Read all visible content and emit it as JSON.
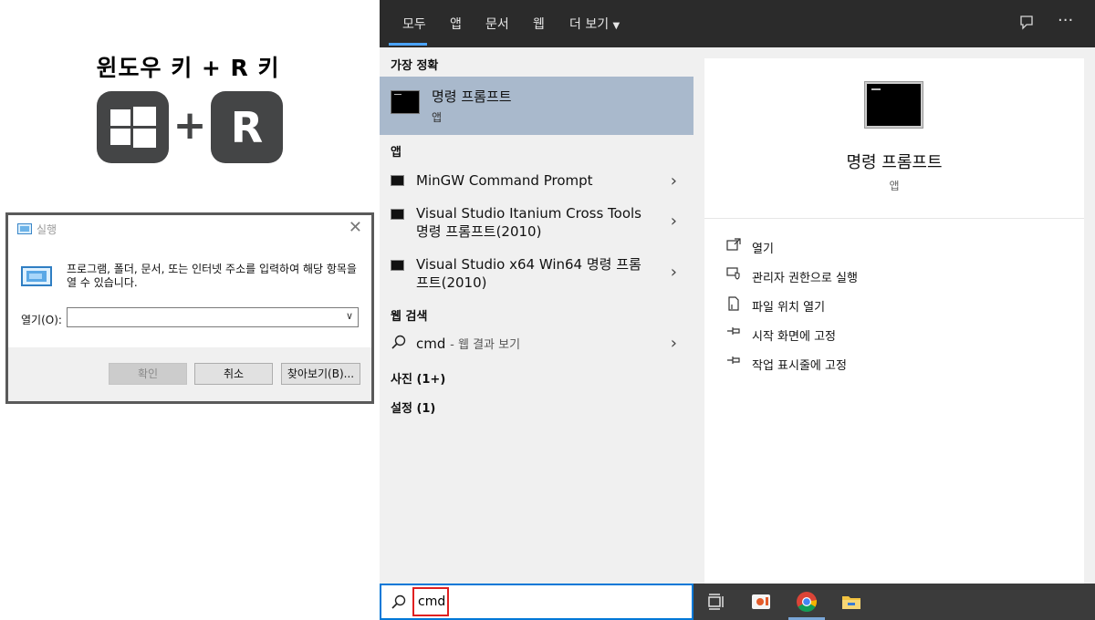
{
  "shortcut": {
    "title": "윈도우 키 + R 키",
    "plus": "+",
    "r_key": "R",
    "win_key_icon": "windows-logo-icon"
  },
  "run_dialog": {
    "title": "실행",
    "description": "프로그램, 폴더, 문서, 또는 인터넷 주소를 입력하여 해당 항목을 열 수 있습니다.",
    "open_label": "열기(O):",
    "open_value": "",
    "ok_label": "확인",
    "cancel_label": "취소",
    "browse_label": "찾아보기(B)..."
  },
  "search": {
    "tabs": [
      {
        "label": "모두"
      },
      {
        "label": "앱"
      },
      {
        "label": "문서"
      },
      {
        "label": "웹"
      },
      {
        "label": "더 보기"
      }
    ],
    "best_match_header": "가장 정확",
    "best_match": {
      "title": "명령 프롬프트",
      "subtitle": "앱"
    },
    "apps_header": "앱",
    "apps": [
      {
        "label": "MinGW Command Prompt"
      },
      {
        "label": "Visual Studio Itanium Cross Tools 명령 프롬프트(2010)"
      },
      {
        "label": "Visual Studio x64 Win64 명령 프롬프트(2010)"
      }
    ],
    "web_header": "웹 검색",
    "web_item": {
      "query": "cmd",
      "suffix": "- 웹 결과 보기"
    },
    "photos_header": "사진 (1+)",
    "settings_header": "설정 (1)",
    "preview": {
      "title": "명령 프롬프트",
      "subtitle": "앱",
      "actions": [
        {
          "label": "열기",
          "icon": "open-icon"
        },
        {
          "label": "관리자 권한으로 실행",
          "icon": "admin-shield-icon"
        },
        {
          "label": "파일 위치 열기",
          "icon": "file-location-icon"
        },
        {
          "label": "시작 화면에 고정",
          "icon": "pin-icon"
        },
        {
          "label": "작업 표시줄에 고정",
          "icon": "pin-icon"
        }
      ]
    },
    "query": "cmd"
  },
  "colors": {
    "accent": "#0078d7",
    "selection": "#a9b9cc",
    "topbar": "#2b2b2b",
    "taskbar": "#3b3b3b",
    "highlight_red": "#e02020"
  }
}
